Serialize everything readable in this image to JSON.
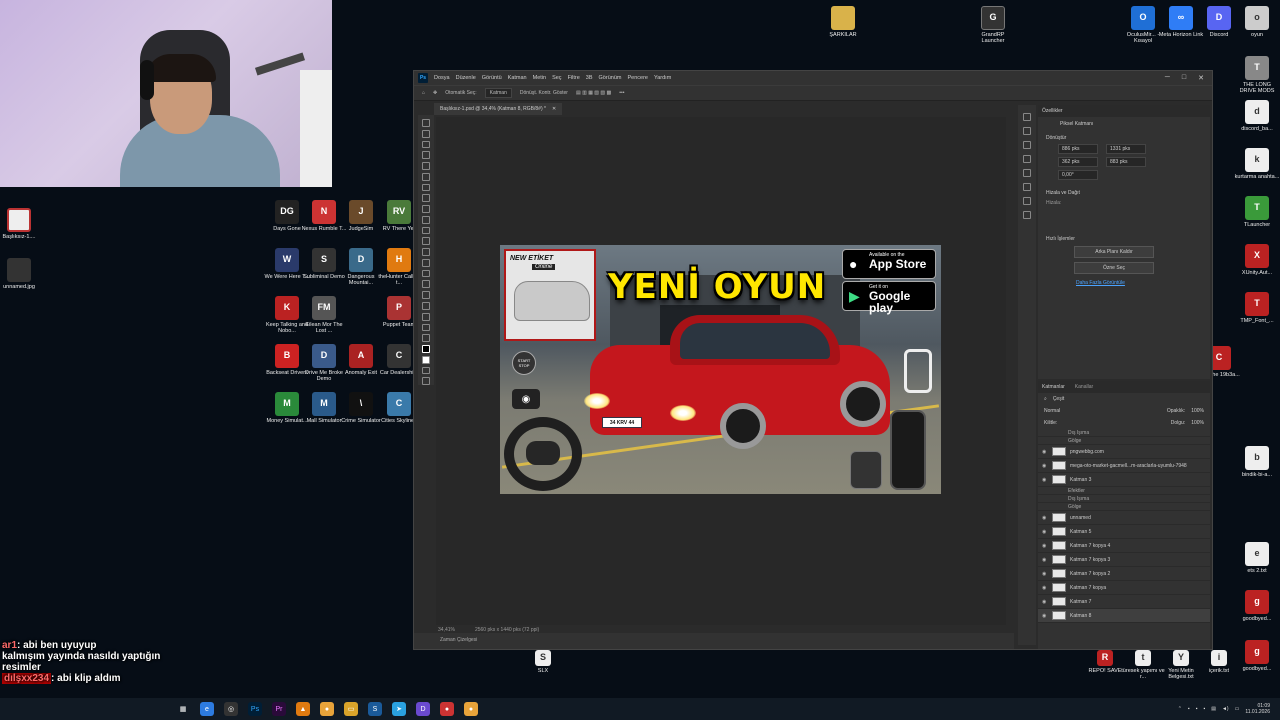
{
  "webcam": {},
  "desktop": {
    "left_icons": [
      {
        "label": "Başlıksız-1....",
        "color": "#b33"
      },
      {
        "label": "unnamed.jpg",
        "color": "#444"
      }
    ],
    "game_icons": [
      {
        "label": "Days Gone",
        "color": "#222",
        "glyph": "DG"
      },
      {
        "label": "Nexus Rumble T...",
        "color": "#c33",
        "glyph": "N"
      },
      {
        "label": "JudgeSim",
        "color": "#6a4a2a",
        "glyph": "J"
      },
      {
        "label": "RV There Yet",
        "color": "#4a7a3a",
        "glyph": "RV"
      },
      {
        "label": "We Were Here T...",
        "color": "#2a3a6a",
        "glyph": "W"
      },
      {
        "label": "Subliminal Demo",
        "color": "#333",
        "glyph": "S"
      },
      {
        "label": "Dangerous Mountai...",
        "color": "#3a6a8a",
        "glyph": "D"
      },
      {
        "label": "theHunter Call of t...",
        "color": "#e07a10",
        "glyph": "H"
      },
      {
        "label": "Keep Talking and Nobo...",
        "color": "#b22",
        "glyph": "K"
      },
      {
        "label": "Eilean Mor The Lost ...",
        "color": "#555",
        "glyph": "FM"
      },
      {
        "label": "",
        "color": "transparent",
        "glyph": ""
      },
      {
        "label": "Puppet Team",
        "color": "#a33",
        "glyph": "P"
      },
      {
        "label": "Backseat Drivers",
        "color": "#c22",
        "glyph": "B"
      },
      {
        "label": "Drive Me Broke Demo",
        "color": "#3a5a8a",
        "glyph": "D"
      },
      {
        "label": "Anomaly Exit",
        "color": "#a22",
        "glyph": "A"
      },
      {
        "label": "Car Dealershi...",
        "color": "#333",
        "glyph": "C"
      },
      {
        "label": "Money Simulat...",
        "color": "#2a8a3a",
        "glyph": "M"
      },
      {
        "label": "Mall Simulator",
        "color": "#2a5a8a",
        "glyph": "M"
      },
      {
        "label": "Crime Simulator",
        "color": "#111",
        "glyph": "\\"
      },
      {
        "label": "Cities Skylines",
        "color": "#3a7aaa",
        "glyph": "C"
      }
    ],
    "right_icons": [
      {
        "label": "OculusMir... - Kısayol",
        "color": "#1f6fd6",
        "glyph": "O"
      },
      {
        "label": "Meta Horizon Link",
        "color": "#2f7df6",
        "glyph": "∞"
      },
      {
        "label": "Discord",
        "color": "#5865f2",
        "glyph": "D"
      },
      {
        "label": "oyun",
        "color": "#ccc",
        "glyph": "o"
      },
      {
        "label": "THE LONG DRIVE MODS",
        "color": "#888",
        "glyph": "T"
      },
      {
        "label": "discord_ba...",
        "color": "#eee",
        "glyph": "d"
      },
      {
        "label": "kurtarma anahta...",
        "color": "#eee",
        "glyph": "k"
      },
      {
        "label": "TLauncher",
        "color": "#3a9a3a",
        "glyph": "T"
      },
      {
        "label": "XUnity.Aut...",
        "color": "#b22",
        "glyph": "X"
      },
      {
        "label": "TMP_Font_...",
        "color": "#b22",
        "glyph": "T"
      },
      {
        "label": "CX_The 19b3a...",
        "color": "#b22",
        "glyph": "C"
      },
      {
        "label": "bindik-bi-a...",
        "color": "#eee",
        "glyph": "b"
      },
      {
        "label": "ets 2.txt",
        "color": "#eee",
        "glyph": "e"
      },
      {
        "label": "goodbyed...",
        "color": "#b22",
        "glyph": "g"
      },
      {
        "label": "goodbyed...",
        "color": "#b22",
        "glyph": "g"
      }
    ],
    "top_icons": [
      {
        "label": "ŞARKILAR",
        "color": "#d9b24a",
        "glyph": "Ş"
      },
      {
        "label": "GrandRP Launcher",
        "color": "#333",
        "glyph": "G"
      }
    ],
    "bottom_icons": [
      {
        "label": "SLX",
        "color": "#eee",
        "glyph": "S"
      },
      {
        "label": "REPO! SAVE",
        "color": "#b22",
        "glyph": "R"
      },
      {
        "label": "türesek yapımı ve r...",
        "color": "#eee",
        "glyph": "t"
      },
      {
        "label": "Yeni Metin Belgesi.txt",
        "color": "#eee",
        "glyph": "Y"
      },
      {
        "label": "içerik.txt",
        "color": "#eee",
        "glyph": "i"
      },
      {
        "label": "goodbyed...",
        "color": "#b22",
        "glyph": "g"
      }
    ]
  },
  "photoshop": {
    "logo": "Ps",
    "menu": [
      "Dosya",
      "Düzenle",
      "Görüntü",
      "Katman",
      "Metin",
      "Seç",
      "Filtre",
      "3B",
      "Görünüm",
      "Pencere",
      "Yardım"
    ],
    "options": {
      "auto_select": "Otomatik Seç:",
      "auto_select_value": "Katman",
      "transform_controls": "Dönüşt. Kontr. Göster"
    },
    "doc_tab": "Başlıksız-1.psd @ 34,4% (Katman 8, RGB/8#) *",
    "status": {
      "zoom": "34,41%",
      "size": "2560 pks x 1440 pks (72 ppi)"
    },
    "timeline": "Zaman Çizelgesi",
    "properties": {
      "tab": "Özellikler",
      "pixel_layer": "Piksel Katmanı",
      "transform": "Dönüştür",
      "w": "886 pks",
      "h": "1331 pks",
      "x": "362 pks",
      "y": "883 pks",
      "angle": "0,00°",
      "align": "Hizala ve Dağıt",
      "align_sub": "Hizala:",
      "quick": "Hızlı İşlemler",
      "btn1": "Arka Planı Kaldır",
      "btn2": "Özne Seç",
      "more": "Daha Fazla Görüntüle"
    },
    "layers": {
      "tab1": "Katmanlar",
      "tab2": "Kanallar",
      "kind": "Çeşit",
      "mode": "Normal",
      "opacity_label": "Opaklık:",
      "opacity": "100%",
      "lock_label": "Kilitle:",
      "fill_label": "Dolgu:",
      "fill": "100%",
      "rows": [
        {
          "name": "Dış Işıma",
          "sub": true
        },
        {
          "name": "Gölge",
          "sub": true
        },
        {
          "name": "pngwebbg.com",
          "sub": false
        },
        {
          "name": "mega-oto-market-gacmell...m-araclarla-uyumlu-7948",
          "sub": false
        },
        {
          "name": "Katman 3",
          "sub": false
        },
        {
          "name": "Efektler",
          "sub": true
        },
        {
          "name": "Dış Işıma",
          "sub": true
        },
        {
          "name": "Gölge",
          "sub": true
        },
        {
          "name": "unnamed",
          "sub": false
        },
        {
          "name": "Katman 5",
          "sub": false
        },
        {
          "name": "Katman 7 kopya 4",
          "sub": false
        },
        {
          "name": "Katman 7 kopya 3",
          "sub": false
        },
        {
          "name": "Katman 7 kopya 2",
          "sub": false
        },
        {
          "name": "Katman 7 kopya",
          "sub": false
        },
        {
          "name": "Katman 7",
          "sub": false
        },
        {
          "name": "Katman 8",
          "sub": false,
          "selected": true
        }
      ]
    }
  },
  "banner": {
    "title": "YENİ OYUN",
    "thumb_label": "NEW ETİKET",
    "thumb_sub": "Online",
    "plate": "34 KRV 44",
    "appstore_small": "Available on the",
    "appstore_big": "App Store",
    "gplay_small": "Get it on",
    "gplay_big": "Google play",
    "startstop": "START STOP"
  },
  "chat": [
    {
      "name": "ar1",
      "text": ": abi ben uyuyup"
    },
    {
      "name": "",
      "text": "kalmışım yayında nasıldı yaptığın"
    },
    {
      "name": "",
      "text": "resimler"
    },
    {
      "name": "dılşxx234",
      "text": ": abi klip aldım"
    }
  ],
  "taskbar": {
    "time": "01:09",
    "date": "11.01.2026"
  }
}
